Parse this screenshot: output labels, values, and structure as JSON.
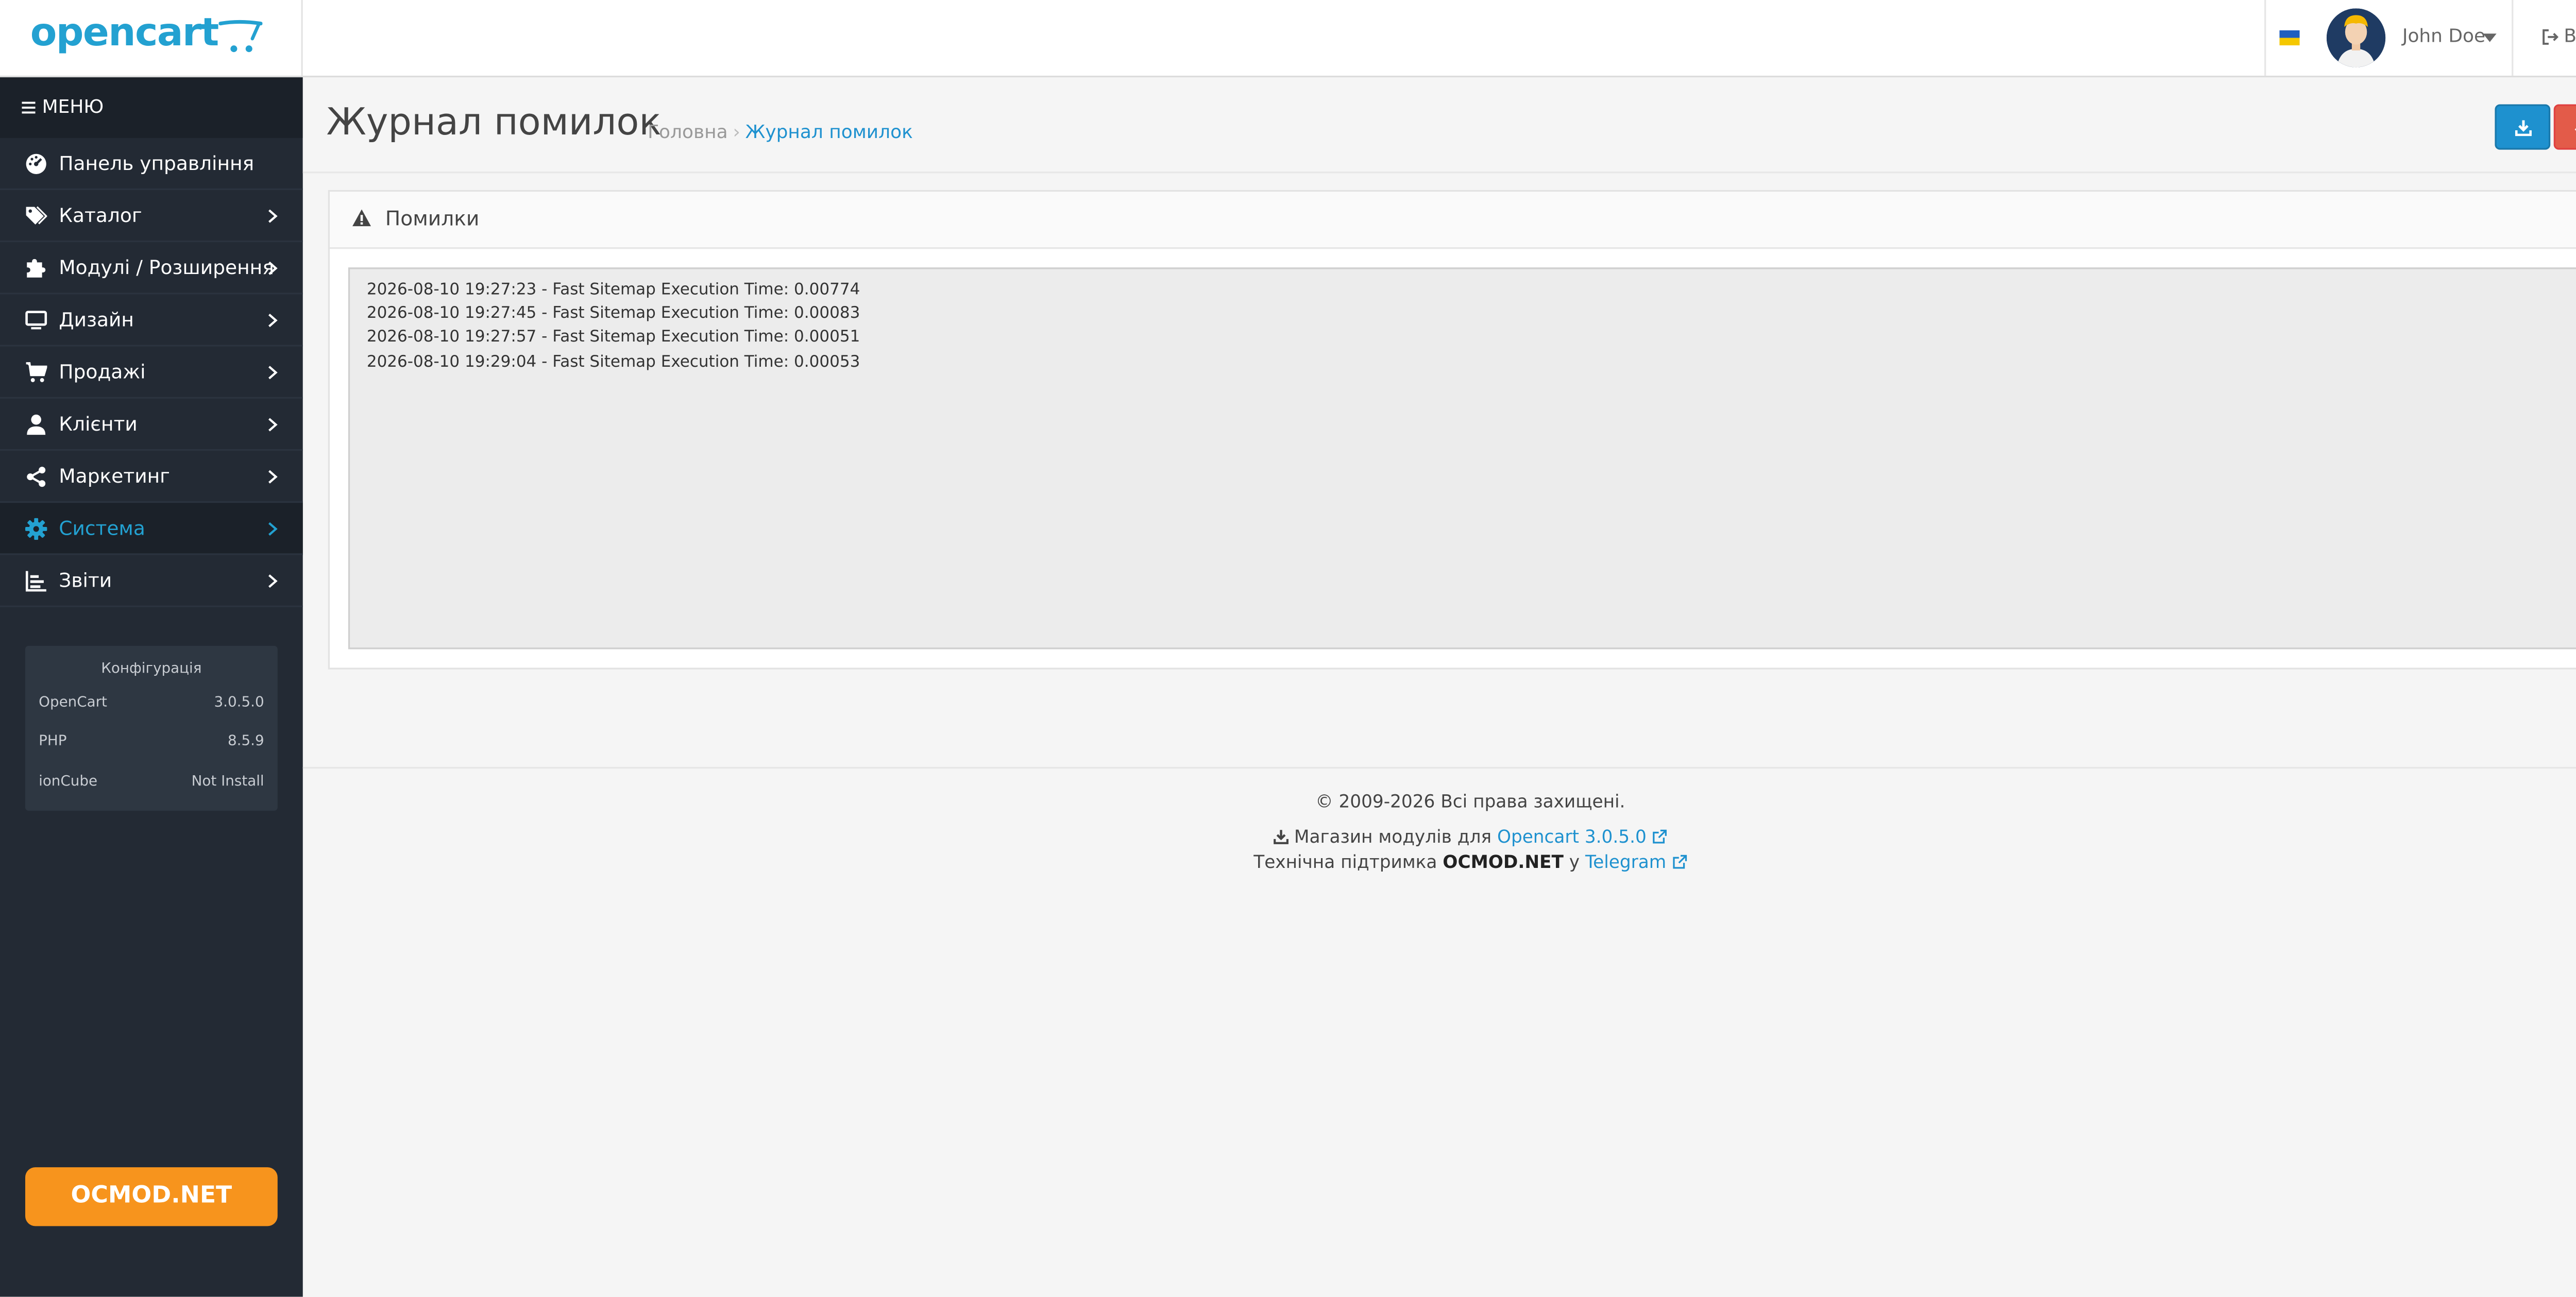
{
  "header": {
    "logo_text": "opencart",
    "user_name": "John Doe",
    "logout_label": "Вихід"
  },
  "sidebar": {
    "menu_title": "МЕНЮ",
    "items": [
      {
        "label": "Панель управління",
        "icon": "dashboard-icon"
      },
      {
        "label": "Каталог",
        "icon": "tags-icon"
      },
      {
        "label": "Модулі / Розширення",
        "icon": "puzzle-icon"
      },
      {
        "label": "Дизайн",
        "icon": "monitor-icon"
      },
      {
        "label": "Продажі",
        "icon": "cart-icon"
      },
      {
        "label": "Клієнти",
        "icon": "user-icon"
      },
      {
        "label": "Маркетинг",
        "icon": "share-icon"
      },
      {
        "label": "Система",
        "icon": "gear-icon",
        "active": true
      },
      {
        "label": "Звіти",
        "icon": "bar-chart-icon"
      }
    ],
    "config": {
      "title": "Конфігурація",
      "rows": [
        {
          "name": "OpenCart",
          "value": "3.0.5.0"
        },
        {
          "name": "PHP",
          "value": "8.5.9"
        },
        {
          "name": "ionCube",
          "value": "Not Install"
        }
      ]
    },
    "ocmod_button": "OCMOD.NET"
  },
  "page": {
    "title": "Журнал помилок",
    "breadcrumb": [
      "Головна",
      "Журнал помилок"
    ]
  },
  "panel": {
    "title": "Помилки",
    "log_lines": [
      "2026-08-10 19:27:23 - Fast Sitemap Execution Time: 0.00774",
      "2026-08-10 19:27:45 - Fast Sitemap Execution Time: 0.00083",
      "2026-08-10 19:27:57 - Fast Sitemap Execution Time: 0.00051",
      "2026-08-10 19:29:04 - Fast Sitemap Execution Time: 0.00053"
    ]
  },
  "footer": {
    "copyright": "© 2009-2026 Всі права захищені.",
    "store_prefix": "Магазин модулів для",
    "store_link": "Opencart 3.0.5.0",
    "support_prefix": "Технічна підтримка",
    "support_brand": "OCMOD.NET",
    "support_mid": "у",
    "support_link": "Telegram"
  },
  "colors": {
    "accent": "#1e91cf",
    "sidebar_bg": "#232a34",
    "danger": "#e35b49",
    "ocmod": "#f7941d"
  }
}
